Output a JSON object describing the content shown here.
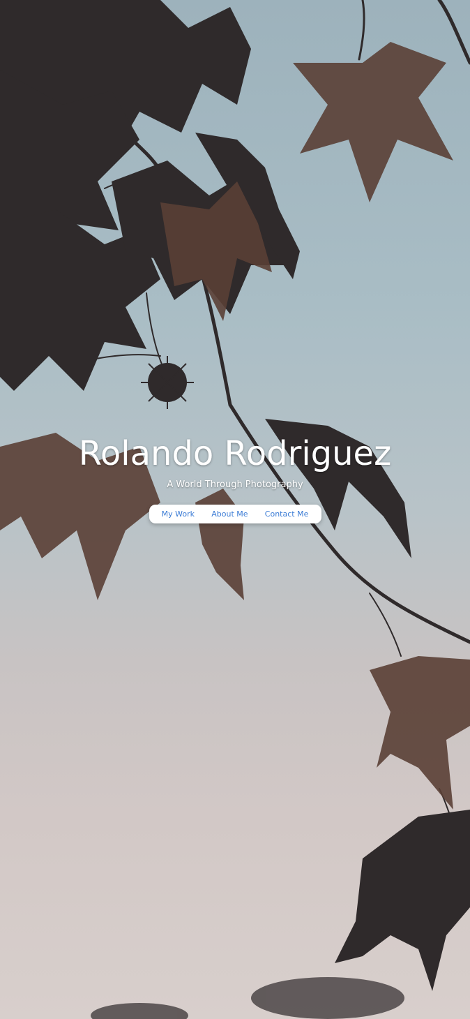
{
  "hero": {
    "title": "Rolando Rodriguez",
    "tagline": "A World Through Photography",
    "background_image": "silhouetted-maple-leaves-against-sky"
  },
  "nav": {
    "items": [
      {
        "label": "My Work"
      },
      {
        "label": "About Me"
      },
      {
        "label": "Contact Me"
      }
    ]
  },
  "colors": {
    "sky_top": "#9db2bc",
    "sky_bottom": "#d8cfcc",
    "leaf_dark": "#2f2a2b",
    "leaf_brown": "#5a3f35",
    "link": "#3a7bd5"
  }
}
